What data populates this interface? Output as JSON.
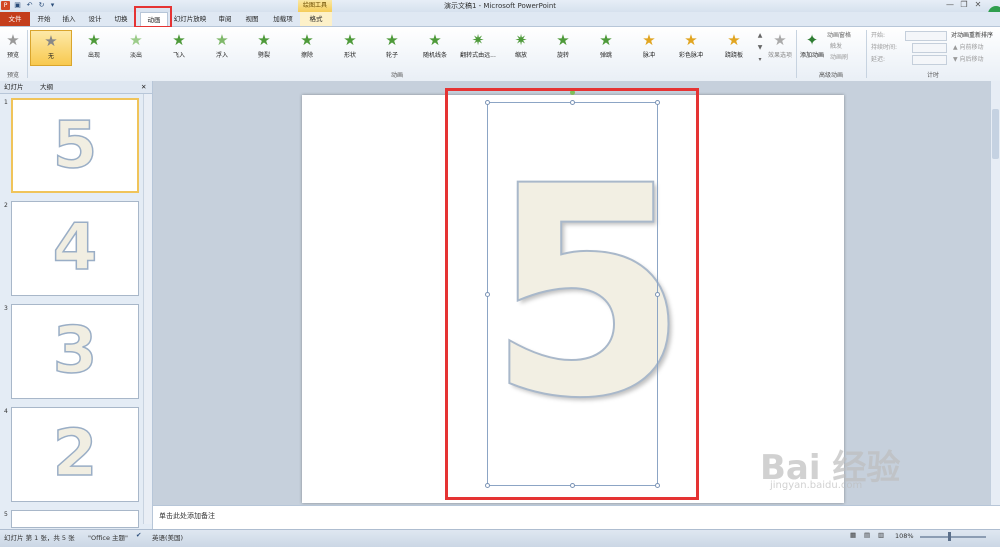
{
  "window": {
    "title": "演示文稿1 - Microsoft PowerPoint",
    "drawing_tools_label": "绘图工具",
    "minimize": "—",
    "restore": "❐",
    "close": "✕"
  },
  "tabs": [
    {
      "label": "文件"
    },
    {
      "label": "开始"
    },
    {
      "label": "插入"
    },
    {
      "label": "设计"
    },
    {
      "label": "切换"
    },
    {
      "label": "动画"
    },
    {
      "label": "幻灯片放映"
    },
    {
      "label": "审阅"
    },
    {
      "label": "视图"
    },
    {
      "label": "加载项"
    },
    {
      "label": "格式"
    }
  ],
  "ribbon": {
    "preview": {
      "label": "预览",
      "group": "预览"
    },
    "animations": [
      {
        "label": "无"
      },
      {
        "label": "出现"
      },
      {
        "label": "淡出"
      },
      {
        "label": "飞入"
      },
      {
        "label": "浮入"
      },
      {
        "label": "劈裂"
      },
      {
        "label": "擦除"
      },
      {
        "label": "形状"
      },
      {
        "label": "轮子"
      },
      {
        "label": "随机线条"
      },
      {
        "label": "翻转式由远..."
      },
      {
        "label": "缩放"
      },
      {
        "label": "旋转"
      },
      {
        "label": "弹跳"
      },
      {
        "label": "脉冲"
      },
      {
        "label": "彩色脉冲"
      },
      {
        "label": "跷跷板"
      }
    ],
    "animation_group": "动画",
    "effect_options": "效果选项",
    "add_animation": "添加动画",
    "animation_pane": "动画窗格",
    "trigger": "触发",
    "animation_painter": "动画刷",
    "advanced_group": "高级动画",
    "start_label": "开始:",
    "duration_label": "持续时间:",
    "delay_label": "延迟:",
    "reorder_label": "对动画重新排序",
    "move_earlier": "▲ 向前移动",
    "move_later": "▼ 向后移动",
    "timing_group": "计时"
  },
  "pane": {
    "tab_slides": "幻灯片",
    "tab_outline": "大纲",
    "close": "✕",
    "thumbnails": [
      {
        "num": "1",
        "digit": "5"
      },
      {
        "num": "2",
        "digit": "4"
      },
      {
        "num": "3",
        "digit": "3"
      },
      {
        "num": "4",
        "digit": "2"
      },
      {
        "num": "5",
        "digit": ""
      }
    ]
  },
  "slide": {
    "digit": "5"
  },
  "notes": {
    "placeholder": "单击此处添加备注"
  },
  "status": {
    "slide_info": "幻灯片 第 1 张，共 5 张",
    "theme": "\"Office 主题\"",
    "language": "英语(美国)",
    "zoom": "108%"
  },
  "watermark": {
    "brand": "Bai 经验",
    "url": "jingyan.baidu.com"
  },
  "colors": {
    "accent_red": "#e53333",
    "file_tab": "#c43e1c",
    "selected_anim": "#f8c94f"
  }
}
